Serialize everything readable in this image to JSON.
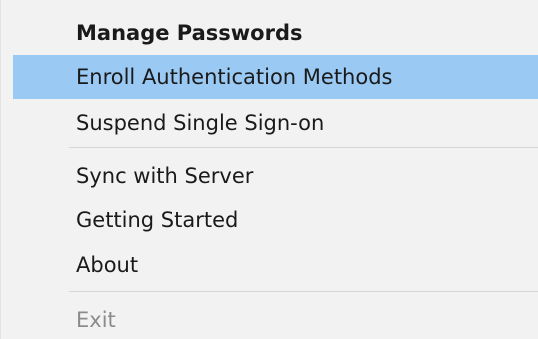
{
  "menu": {
    "items": [
      {
        "label": "Manage Passwords",
        "state": "default-bold"
      },
      {
        "label": "Enroll Authentication Methods",
        "state": "highlighted"
      },
      {
        "label": "Suspend Single Sign-on",
        "state": "normal"
      },
      {
        "label": "Sync with Server",
        "state": "normal"
      },
      {
        "label": "Getting Started",
        "state": "normal"
      },
      {
        "label": "About",
        "state": "normal"
      },
      {
        "label": "Exit",
        "state": "disabled"
      }
    ]
  },
  "colors": {
    "menu_background": "#f2f2f2",
    "highlight": "#9ac9f3",
    "text": "#1a1a1a",
    "disabled_text": "#8c8c8c",
    "separator": "#d5d5d5"
  }
}
